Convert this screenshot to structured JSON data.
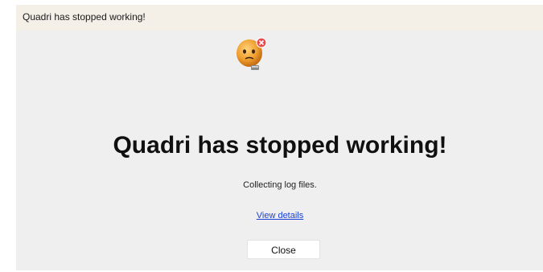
{
  "window": {
    "title": "Quadri has stopped working!"
  },
  "dialog": {
    "icon": "sad-face-error-icon",
    "headline": "Quadri has stopped working!",
    "status": "Collecting log files.",
    "details_link": "View details",
    "close_label": "Close"
  },
  "colors": {
    "titlebar_bg": "#f4f0e8",
    "dialog_bg": "#efefef",
    "link": "#1a3fd6",
    "icon_face": "#f0a030",
    "icon_error": "#e84a4a"
  }
}
